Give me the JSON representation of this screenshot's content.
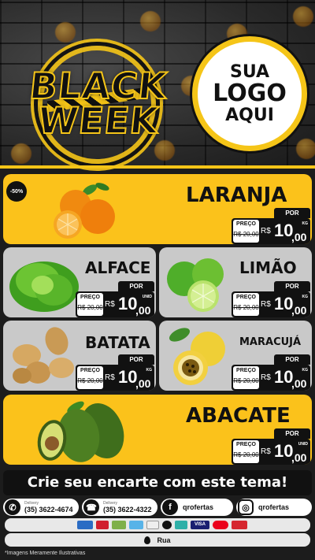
{
  "header": {
    "title_line1": "BLACK",
    "title_line2": "WEEK",
    "logo_line1": "SUA",
    "logo_line2": "LOGO",
    "logo_line3": "AQUI"
  },
  "colors": {
    "accent": "#fbc21b",
    "card_grey": "#c9c9c9",
    "dark": "#111111"
  },
  "discount_badge": "-50%",
  "products": [
    {
      "name": "LARANJA",
      "preco_label": "PREÇO",
      "por_label": "POR",
      "old_price": "R$ 20,00",
      "currency": "R$",
      "price_int": "10",
      "price_dec": ",00",
      "unit": "KG",
      "image": "oranges"
    },
    {
      "name": "ALFACE",
      "preco_label": "PREÇO",
      "por_label": "POR",
      "old_price": "R$ 20,00",
      "currency": "R$",
      "price_int": "10",
      "price_dec": ",00",
      "unit": "UNID",
      "image": "lettuce"
    },
    {
      "name": "LIMÃO",
      "preco_label": "PREÇO",
      "por_label": "POR",
      "old_price": "R$ 20,00",
      "currency": "R$",
      "price_int": "10",
      "price_dec": ",00",
      "unit": "KG",
      "image": "limes"
    },
    {
      "name": "BATATA",
      "preco_label": "PREÇO",
      "por_label": "POR",
      "old_price": "R$ 20,00",
      "currency": "R$",
      "price_int": "10",
      "price_dec": ",00",
      "unit": "KG",
      "image": "potatoes"
    },
    {
      "name": "MARACUJÁ",
      "preco_label": "PREÇO",
      "por_label": "POR",
      "old_price": "R$ 20,00",
      "currency": "R$",
      "price_int": "10",
      "price_dec": ",00",
      "unit": "KG",
      "image": "passion-fruit"
    },
    {
      "name": "ABACATE",
      "preco_label": "PREÇO",
      "por_label": "POR",
      "old_price": "R$ 20,00",
      "currency": "R$",
      "price_int": "10",
      "price_dec": ",00",
      "unit": "UNID",
      "image": "avocados"
    }
  ],
  "cta": "Crie seu encarte com este tema!",
  "contacts": {
    "whatsapp": {
      "small": "Delivery",
      "value": "(35) 3622-4674"
    },
    "phone": {
      "small": "Delivery",
      "value": "(35) 3622-4322"
    },
    "facebook": {
      "value": "qrofertas"
    },
    "instagram": {
      "value": "qrofertas"
    }
  },
  "payment": [
    "VISA"
  ],
  "address": "Rua",
  "disclaimer": "*Imagens Meramente Ilustrativas"
}
